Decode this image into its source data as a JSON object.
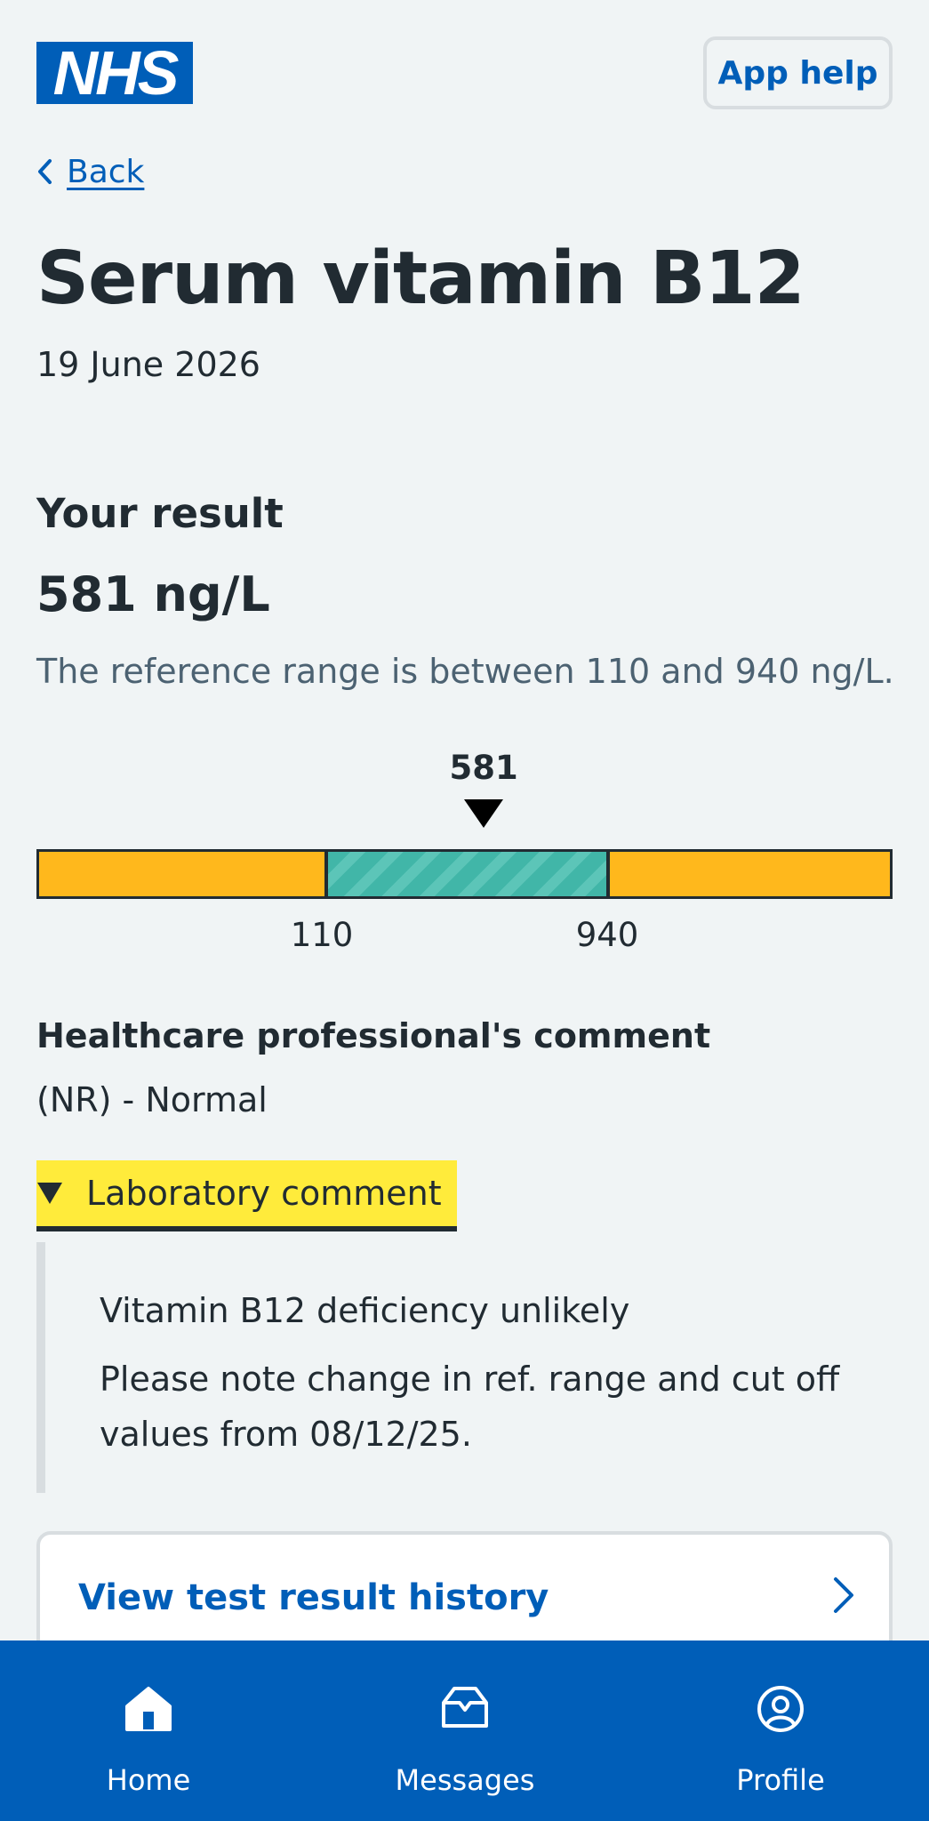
{
  "header": {
    "logo_text": "NHS",
    "app_help_label": "App help"
  },
  "nav_back": {
    "label": "Back"
  },
  "page": {
    "title": "Serum vitamin B12",
    "date": "19 June 2026"
  },
  "result": {
    "heading": "Your result",
    "value": "581 ng/L",
    "reference_text": "The reference range is between 110 and 940 ng/L."
  },
  "range_chart": {
    "marker_label": "581",
    "low_label": "110",
    "high_label": "940",
    "colors": {
      "out_of_range": "#ffb81c",
      "in_range": "#41b6a8"
    }
  },
  "chart_data": {
    "type": "bar",
    "value": 581,
    "reference_low": 110,
    "reference_high": 940,
    "tick_labels": [
      "110",
      "940"
    ],
    "marker_label": "581"
  },
  "hcp_comment": {
    "heading": "Healthcare professional's comment",
    "text": "(NR) - Normal"
  },
  "lab_comment": {
    "toggle_label": "Laboratory comment",
    "line1": "Vitamin B12 deficiency unlikely",
    "line2": "Please note change in ref. range and cut off values from 08/12/25."
  },
  "history_link": {
    "label": "View test result history"
  },
  "bottom_nav": {
    "items": [
      {
        "label": "Home",
        "icon": "home-icon"
      },
      {
        "label": "Messages",
        "icon": "messages-icon"
      },
      {
        "label": "Profile",
        "icon": "profile-icon"
      }
    ]
  },
  "colors": {
    "brand_blue": "#005eb8",
    "background": "#f0f4f5",
    "text": "#212b32",
    "highlight": "#ffeb3b"
  }
}
